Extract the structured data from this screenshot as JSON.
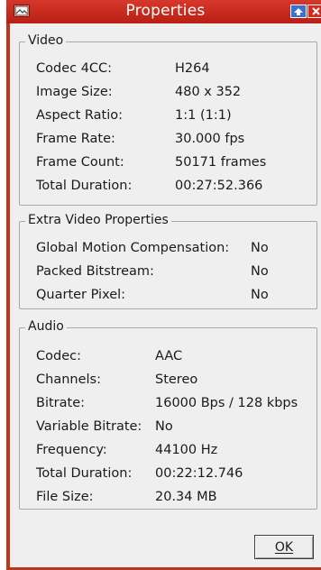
{
  "window": {
    "title": "Properties"
  },
  "video": {
    "legend": "Video",
    "rows": [
      {
        "label": "Codec 4CC:",
        "value": "H264"
      },
      {
        "label": "Image Size:",
        "value": "480 x 352"
      },
      {
        "label": "Aspect Ratio:",
        "value": "1:1 (1:1)"
      },
      {
        "label": "Frame Rate:",
        "value": "30.000 fps"
      },
      {
        "label": "Frame Count:",
        "value": "50171 frames"
      },
      {
        "label": "Total Duration:",
        "value": "00:27:52.366"
      }
    ]
  },
  "extra": {
    "legend": "Extra Video Properties",
    "rows": [
      {
        "label": "Global Motion Compensation:",
        "value": "No"
      },
      {
        "label": "Packed Bitstream:",
        "value": "No"
      },
      {
        "label": "Quarter Pixel:",
        "value": "No"
      }
    ]
  },
  "audio": {
    "legend": "Audio",
    "rows": [
      {
        "label": "Codec:",
        "value": "AAC"
      },
      {
        "label": "Channels:",
        "value": "Stereo"
      },
      {
        "label": "Bitrate:",
        "value": "16000 Bps / 128 kbps"
      },
      {
        "label": "Variable Bitrate:",
        "value": "No"
      },
      {
        "label": "Frequency:",
        "value": "44100 Hz"
      },
      {
        "label": "Total Duration:",
        "value": "00:22:12.746"
      },
      {
        "label": "File Size:",
        "value": "20.34 MB"
      }
    ]
  },
  "buttons": {
    "ok_label": "OK"
  },
  "icons": {
    "window_menu": "window-menu-icon",
    "maximize": "maximize-icon",
    "close": "close-icon"
  },
  "colors": {
    "titlebar": "#c8281c",
    "dialog_background": "#efefef",
    "maximize_button": "#3b6fd0",
    "close_button": "#d52a1e"
  }
}
